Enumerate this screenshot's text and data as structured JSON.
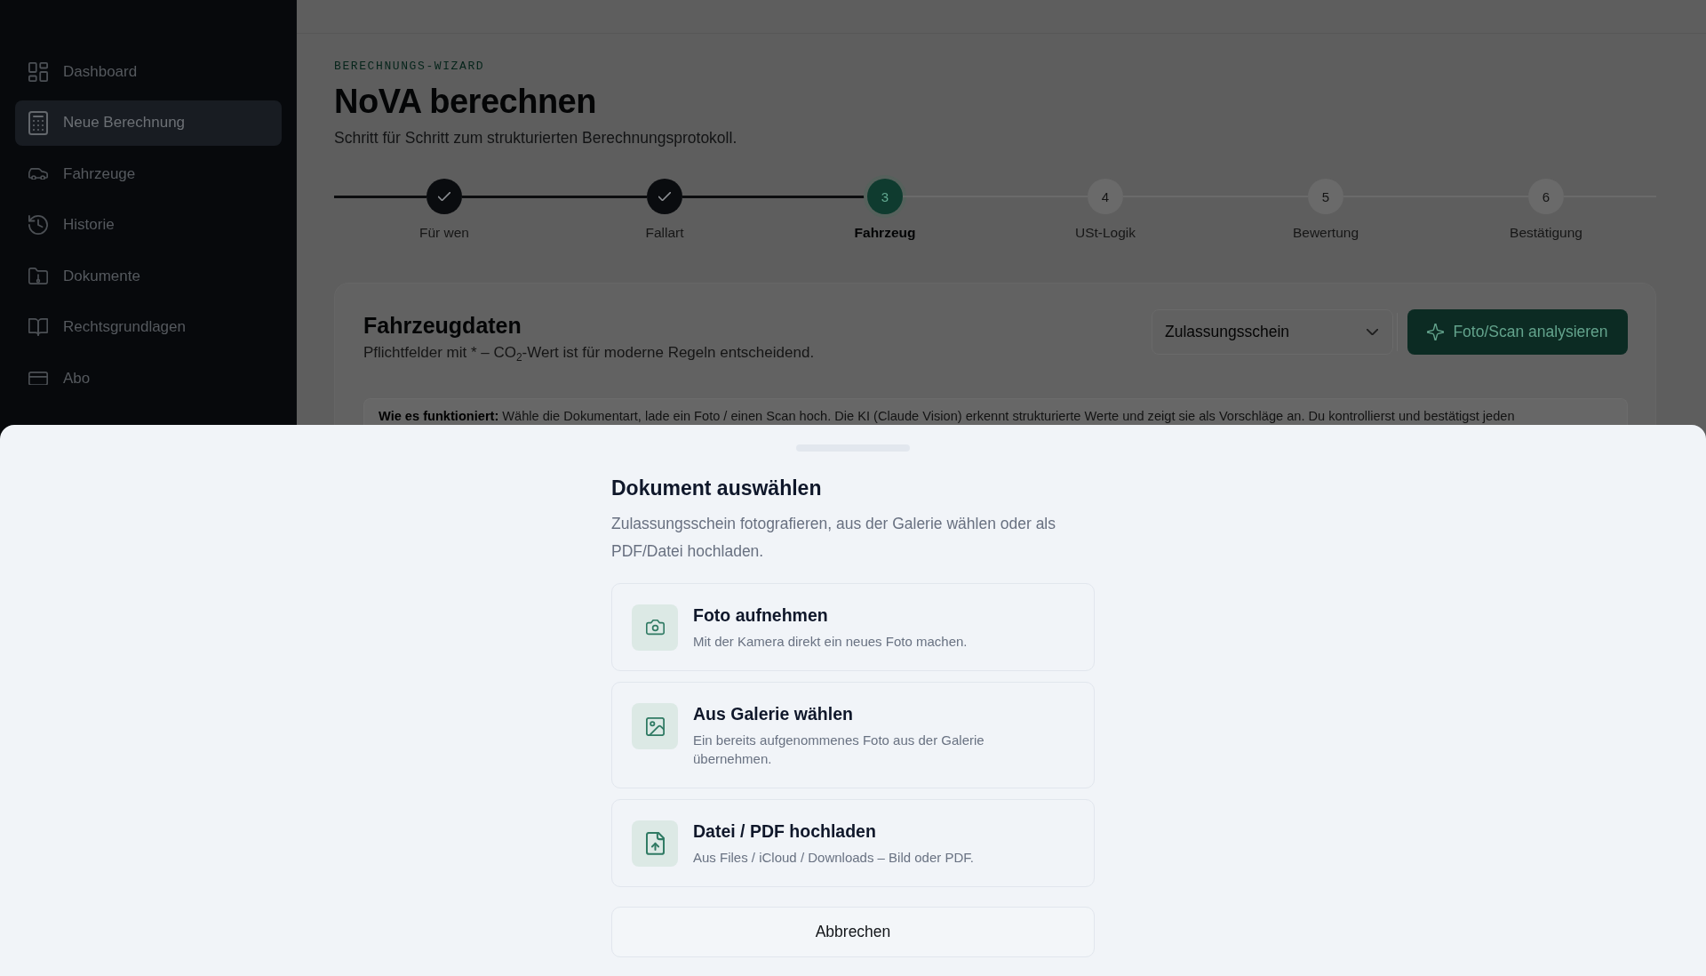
{
  "sidebar": {
    "items": [
      {
        "label": "Dashboard",
        "selected": false
      },
      {
        "label": "Neue Berechnung",
        "selected": true
      },
      {
        "label": "Fahrzeuge",
        "selected": false
      },
      {
        "label": "Historie",
        "selected": false
      },
      {
        "label": "Dokumente",
        "selected": false
      },
      {
        "label": "Rechtsgrundlagen",
        "selected": false
      },
      {
        "label": "Abo",
        "selected": false
      }
    ]
  },
  "page": {
    "eyebrow": "BERECHNUNGS-WIZARD",
    "title": "NoVA berechnen",
    "subtitle": "Schritt für Schritt zum strukturierten Berechnungsprotokoll."
  },
  "stepper": {
    "steps": [
      {
        "label": "Für wen",
        "done": true,
        "selected": false
      },
      {
        "label": "Fallart",
        "done": true,
        "selected": false
      },
      {
        "number": "3",
        "label": "Fahrzeug",
        "done": false,
        "selected": true
      },
      {
        "number": "4",
        "label": "USt-Logik",
        "done": false,
        "selected": false
      },
      {
        "number": "5",
        "label": "Bewertung",
        "done": false,
        "selected": false
      },
      {
        "number": "6",
        "label": "Bestätigung",
        "done": false,
        "selected": false
      }
    ]
  },
  "vehicle_card": {
    "title": "Fahrzeugdaten",
    "subtitle": "Pflichtfelder mit * – CO$_{2}$-Wert ist für moderne Regeln entscheidend.",
    "document_type": {
      "value": "Zulassungsschein"
    },
    "analyze_button": "Foto/Scan analysieren",
    "info": "**Wie es funktioniert:** Wähle die Dokumentart, lade ein Foto / einen Scan hoch. Die KI (Claude Vision) erkennt strukturierte Werte und zeigt sie als Vorschläge an. Du kontrollierst und bestätigst jeden"
  },
  "sheet": {
    "title": "Dokument auswählen",
    "description": "Zulassungsschein fotografieren, aus der Galerie wählen oder als PDF/Datei hochladen.",
    "options": [
      {
        "title": "Foto aufnehmen",
        "description": "Mit der Kamera direkt ein neues Foto machen."
      },
      {
        "title": "Aus Galerie wählen",
        "description": "Ein bereits aufgenommenes Foto aus der Galerie übernehmen."
      },
      {
        "title": "Datei / PDF hochladen",
        "description": "Aus Files / iCloud / Downloads – Bild oder PDF."
      }
    ],
    "cancel_button": "Abbrechen"
  }
}
